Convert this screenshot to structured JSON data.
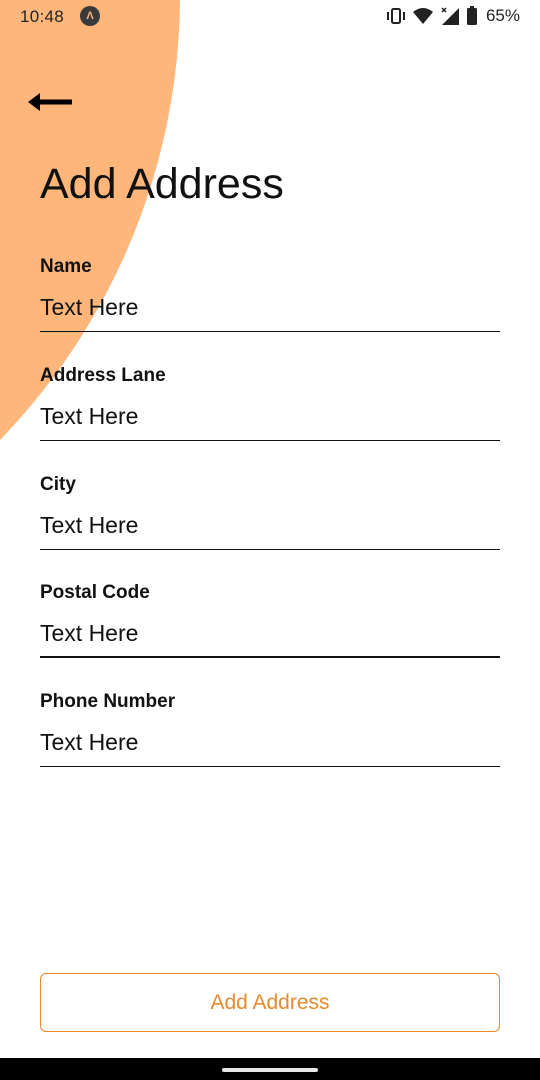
{
  "status_bar": {
    "time": "10:48",
    "app_badge": "Λ",
    "battery_percent": "65%",
    "icons": [
      "vibrate-icon",
      "wifi-icon",
      "signal-icon",
      "battery-icon"
    ]
  },
  "colors": {
    "accent": "#E8892C",
    "background_shape": "#FFB67B",
    "text": "#111111"
  },
  "header": {
    "back_icon": "arrow-left-icon",
    "title": "Add Address"
  },
  "form": {
    "fields": [
      {
        "label": "Name",
        "placeholder": "Text Here",
        "value": ""
      },
      {
        "label": "Address Lane",
        "placeholder": "Text Here",
        "value": ""
      },
      {
        "label": "City",
        "placeholder": "Text Here",
        "value": ""
      },
      {
        "label": "Postal Code",
        "placeholder": "Text Here",
        "value": ""
      },
      {
        "label": "Phone Number",
        "placeholder": "Text Here",
        "value": ""
      }
    ]
  },
  "submit": {
    "label": "Add Address"
  }
}
